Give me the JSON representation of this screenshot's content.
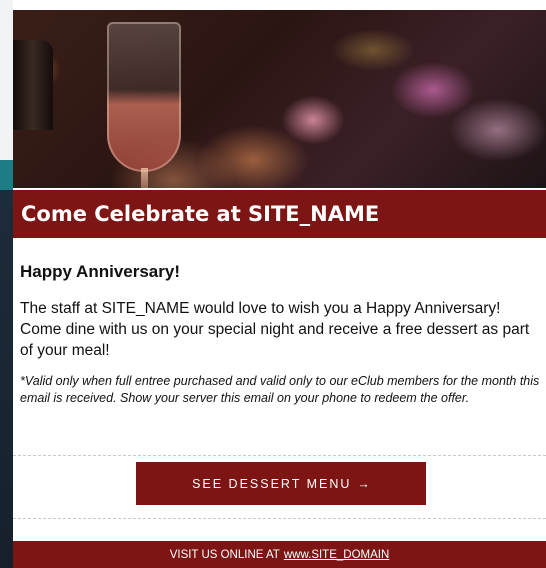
{
  "banner": {
    "title": "Come Celebrate at SITE_NAME"
  },
  "content": {
    "heading": "Happy Anniversary!",
    "body": "The staff at SITE_NAME would love to wish you a Happy Anniversary! Come dine with us on your special night and receive a free dessert as part of your meal!",
    "fine_print": "*Valid only when full entree purchased and valid only to our eClub members for the month this email is received.  Show your server this email on your phone to redeem the offer."
  },
  "cta": {
    "label": "SEE DESSERT MENU",
    "arrow": "→"
  },
  "footer": {
    "prefix": "VISIT US ONLINE AT",
    "link": "www.SITE_DOMAIN"
  },
  "colors": {
    "brand": "#7c1514",
    "side_strip": "#1e2d3b",
    "accent": "#1d7c86"
  }
}
